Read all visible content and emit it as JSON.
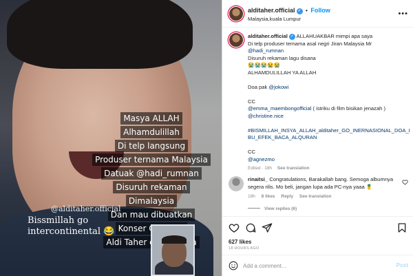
{
  "media": {
    "overlay_lines": [
      "Masya ALLAH",
      "Alhamdulillah",
      "Di telp langsung",
      "Produser ternama Malaysia",
      "Datuak @hadi_rumnan",
      "Disuruh rekaman",
      "Dimalaysia",
      "Dan mau dibuatkan",
      "Konser Coldplay",
      "Aldi Taher di malaysia"
    ],
    "handle_text": "@alditaher.official",
    "bismillah_line1": "Bissmillah go",
    "bismillah_line2": "intercontinental 😂"
  },
  "header": {
    "username": "alditaher.official",
    "verified_mark": "✓",
    "dot": "•",
    "follow_label": "Follow",
    "location": "Malaysia,kuala Lumpur",
    "more_glyph": "•••"
  },
  "caption": {
    "username": "alditaher.official",
    "verified_mark": "✓",
    "line1": " ALLAHUAKBAR mimpi apa saya",
    "line2": "Di telp produser ternama asal negri Jiran Malaysia Mr",
    "line3": "@hadi_rumnan",
    "line4": "Disuruh rekaman lagu disana",
    "line5": "😭😭😭😭😭",
    "line6": "ALHAMDULILLAH YA ALLAH",
    "line7": "",
    "line8_prefix": "Doa pak ",
    "line8_mention": "@jokowi",
    "line9": "",
    "line10": "CC",
    "line11_mention": "@emma_maembongofficial",
    "line11_suffix": " ( istriku di film bisikan jenazah )",
    "line12": "@christine.nice",
    "line13": "",
    "line14": "#BISMILLAH_INSYA_ALLAH_alditaher_GO_INERNASIONAL_DOA_I",
    "line15": "BU_EFEK_BACA_ALQURAN",
    "line16": "",
    "line17": "CC",
    "line18": "@agnezmo",
    "meta_edited": "Edited · 18h",
    "meta_translation": "See translation"
  },
  "comment": {
    "username": "rinaitsi_",
    "text": " Congratulations, Barakallah bang. Semoga albumnya segera rilis. Mo beli, jangan lupa ada PC-nya yaaa 🍍",
    "time": "18h",
    "likes": "8 likes",
    "reply": "Reply",
    "translation": "See translation",
    "view_replies": "View replies (6)"
  },
  "stats": {
    "likes": "627 likes",
    "time_ago": "18 HOURS AGO"
  },
  "add_comment": {
    "placeholder": "Add a comment…",
    "post_label": "Post"
  }
}
